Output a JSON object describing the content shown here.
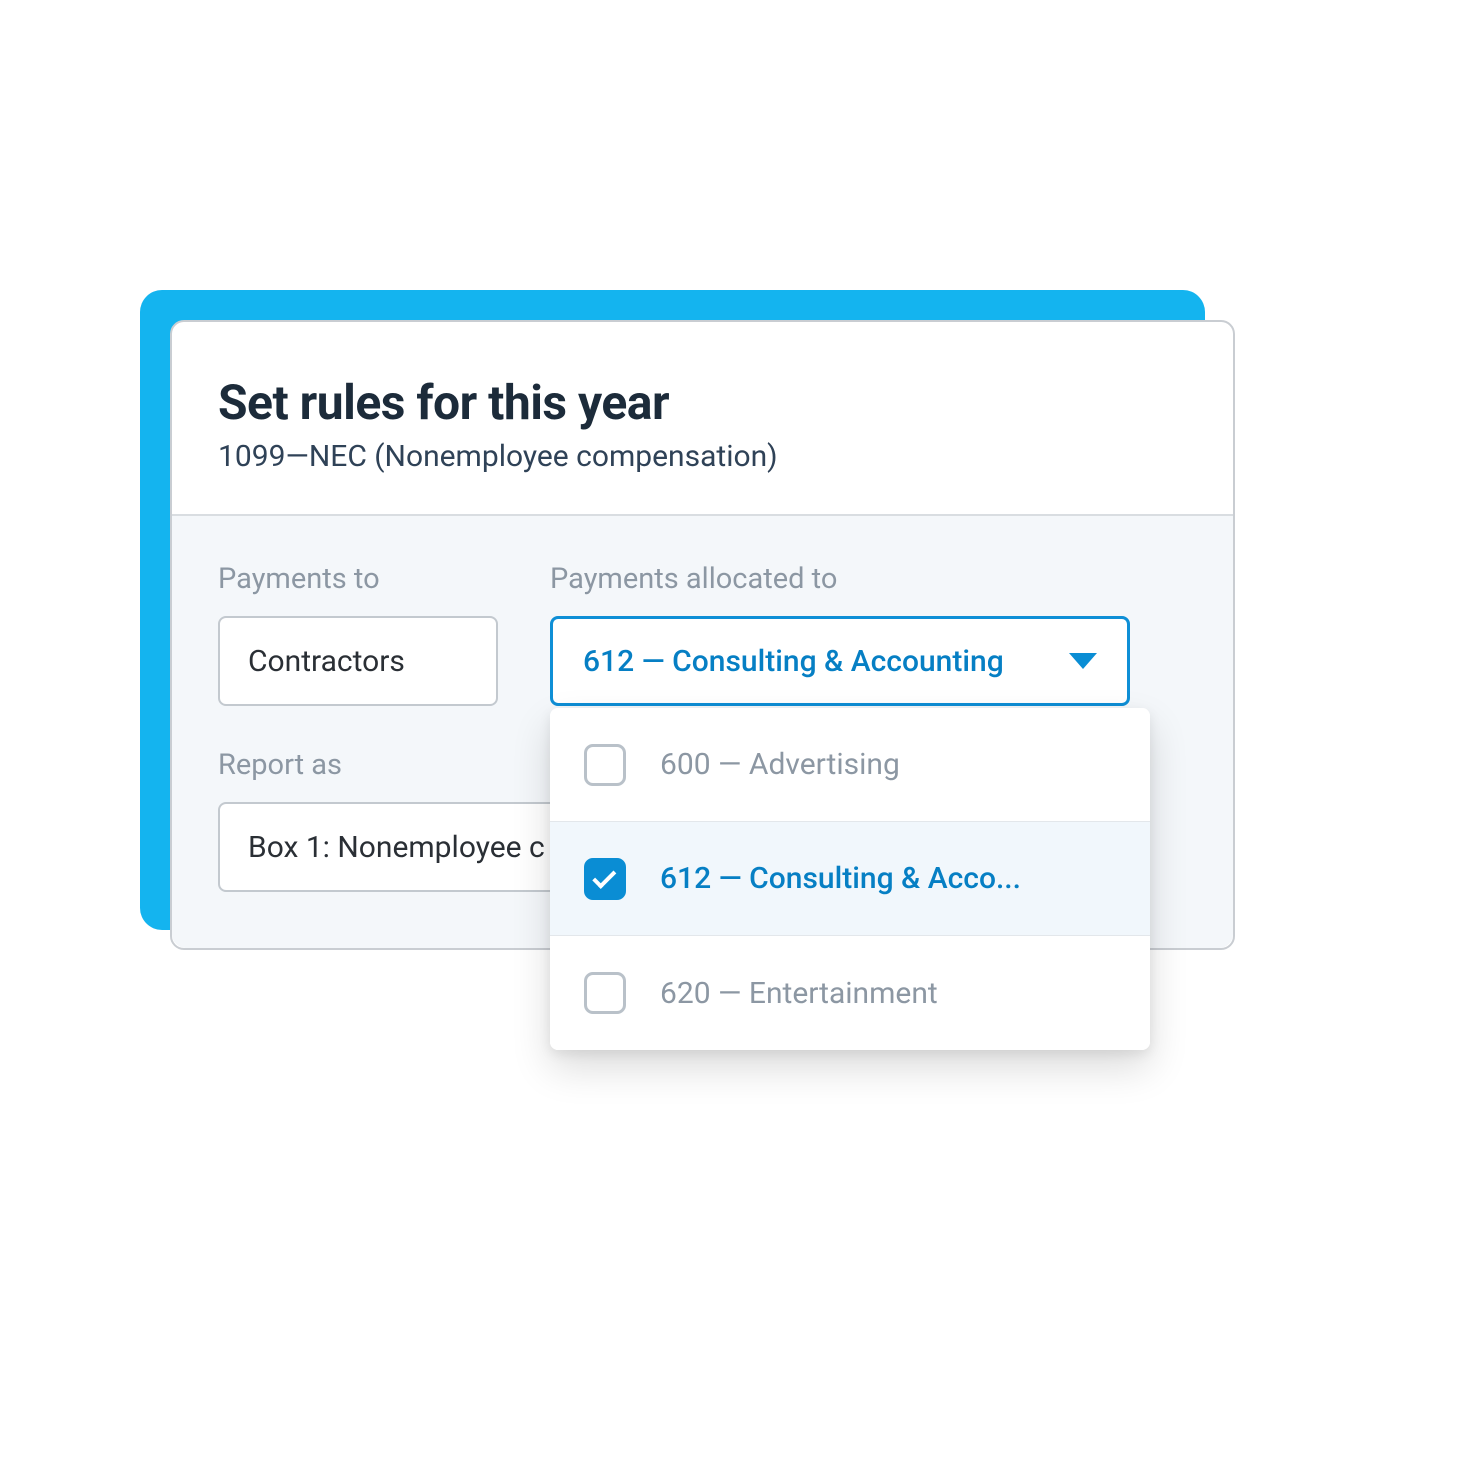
{
  "header": {
    "title": "Set rules for this year",
    "subtitle": "1099—NEC (Nonemployee compensation)"
  },
  "fields": {
    "payments_to": {
      "label": "Payments to",
      "value": "Contractors"
    },
    "payments_allocated": {
      "label": "Payments allocated to",
      "selected_display": "612 — Consulting & Accounting",
      "options": [
        {
          "label": "600 — Advertising",
          "checked": false
        },
        {
          "label": "612 — Consulting & Acco...",
          "checked": true
        },
        {
          "label": "620 — Entertainment",
          "checked": false
        }
      ]
    },
    "report_as": {
      "label": "Report as",
      "value": "Box 1: Nonemployee c"
    }
  },
  "colors": {
    "accent": "#14b4ef",
    "primary": "#0a8dd4"
  }
}
